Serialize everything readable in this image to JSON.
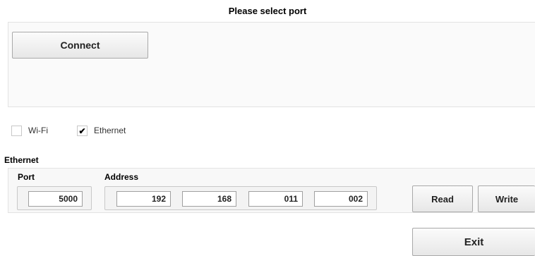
{
  "header": {
    "title": "Please select port"
  },
  "port_panel": {
    "connect_label": "Connect"
  },
  "options": {
    "wifi": {
      "label": "Wi-Fi",
      "checked": false
    },
    "ethernet": {
      "label": "Ethernet",
      "checked": true,
      "check_glyph": "✔"
    }
  },
  "ethernet_section": {
    "label": "Ethernet",
    "port_label": "Port",
    "address_label": "Address",
    "port_value": "5000",
    "address": [
      "192",
      "168",
      "011",
      "002"
    ],
    "read_label": "Read",
    "write_label": "Write"
  },
  "footer": {
    "exit_label": "Exit"
  }
}
